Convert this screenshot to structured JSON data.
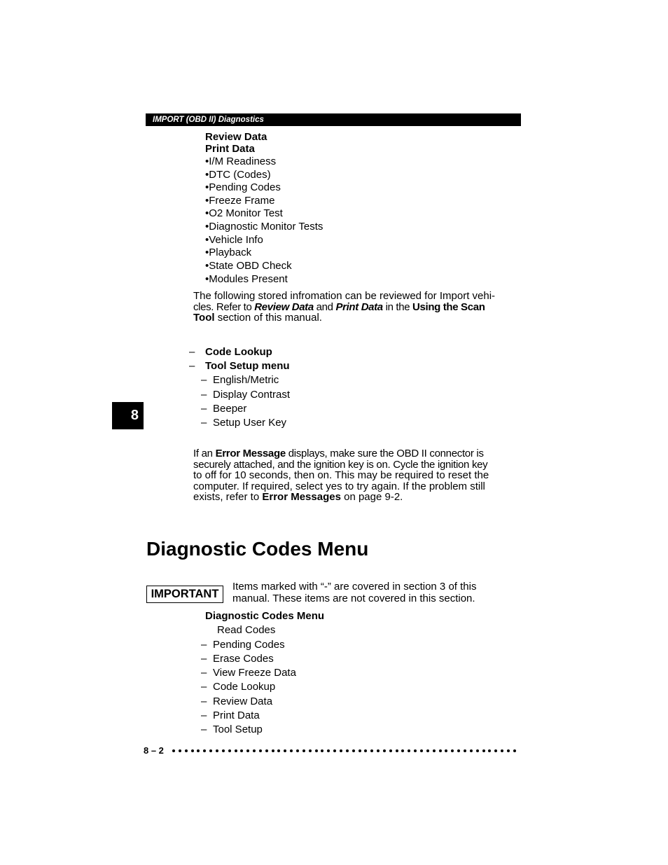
{
  "header": {
    "title": "IMPORT (OBD II) Diagnostics"
  },
  "review_block": {
    "headings": [
      "Review Data",
      "Print Data"
    ],
    "items": [
      "•I/M Readiness",
      "•DTC (Codes)",
      "•Pending Codes",
      "•Freeze Frame",
      "•O2 Monitor Test",
      "•Diagnostic Monitor Tests",
      "•Vehicle Info",
      "•Playback",
      "•State OBD Check",
      "•Modules Present"
    ]
  },
  "info_paragraph": {
    "line1": "The following stored infromation can be reviewed for Import vehi-",
    "line2_pre": "cles. Refer to ",
    "line2_em1": "Review Data",
    "line2_mid": " and ",
    "line2_em2": "Print Data",
    "line2_mid2": " in the ",
    "line2_bold": "Using the Scan",
    "line3_bold": "Tool",
    "line3_post": " section of this manual."
  },
  "menu_block": {
    "dash": "–",
    "top_items": [
      "Code Lookup",
      "Tool Setup menu"
    ],
    "sub_items": [
      "English/Metric",
      "Display Contrast",
      "Beeper",
      "Setup User Key"
    ]
  },
  "chapter_tab": {
    "label": "8"
  },
  "error_paragraph": {
    "l1_pre": "If an ",
    "l1_bold": "Error Message",
    "l1_post": " displays, make sure the OBD  II connector is",
    "l2": "securely attached, and the ignition key is on. Cycle the ignition key",
    "l3": "to off for 10 seconds, then on. This may be required to reset the",
    "l4": "computer. If required, select yes to try again. If the problem still",
    "l5_pre": "exists, refer to ",
    "l5_bold": "Error Messages",
    "l5_post": " on page 9-2."
  },
  "section": {
    "title": "Diagnostic Codes Menu"
  },
  "important_note": {
    "badge": "IMPORTANT",
    "line1": "Items marked with “-” are covered in section 3 of this",
    "line2": "manual. These items are not covered in this section."
  },
  "codes_menu": {
    "heading": "Diagnostic Codes Menu",
    "first_item": "Read Codes",
    "dash": "–",
    "items": [
      "Pending Codes",
      "Erase Codes",
      "View Freeze Data",
      "Code Lookup",
      "Review Data",
      "Print Data",
      "Tool Setup"
    ]
  },
  "footer": {
    "page_number": "8 – 2",
    "dot_count": 56
  }
}
